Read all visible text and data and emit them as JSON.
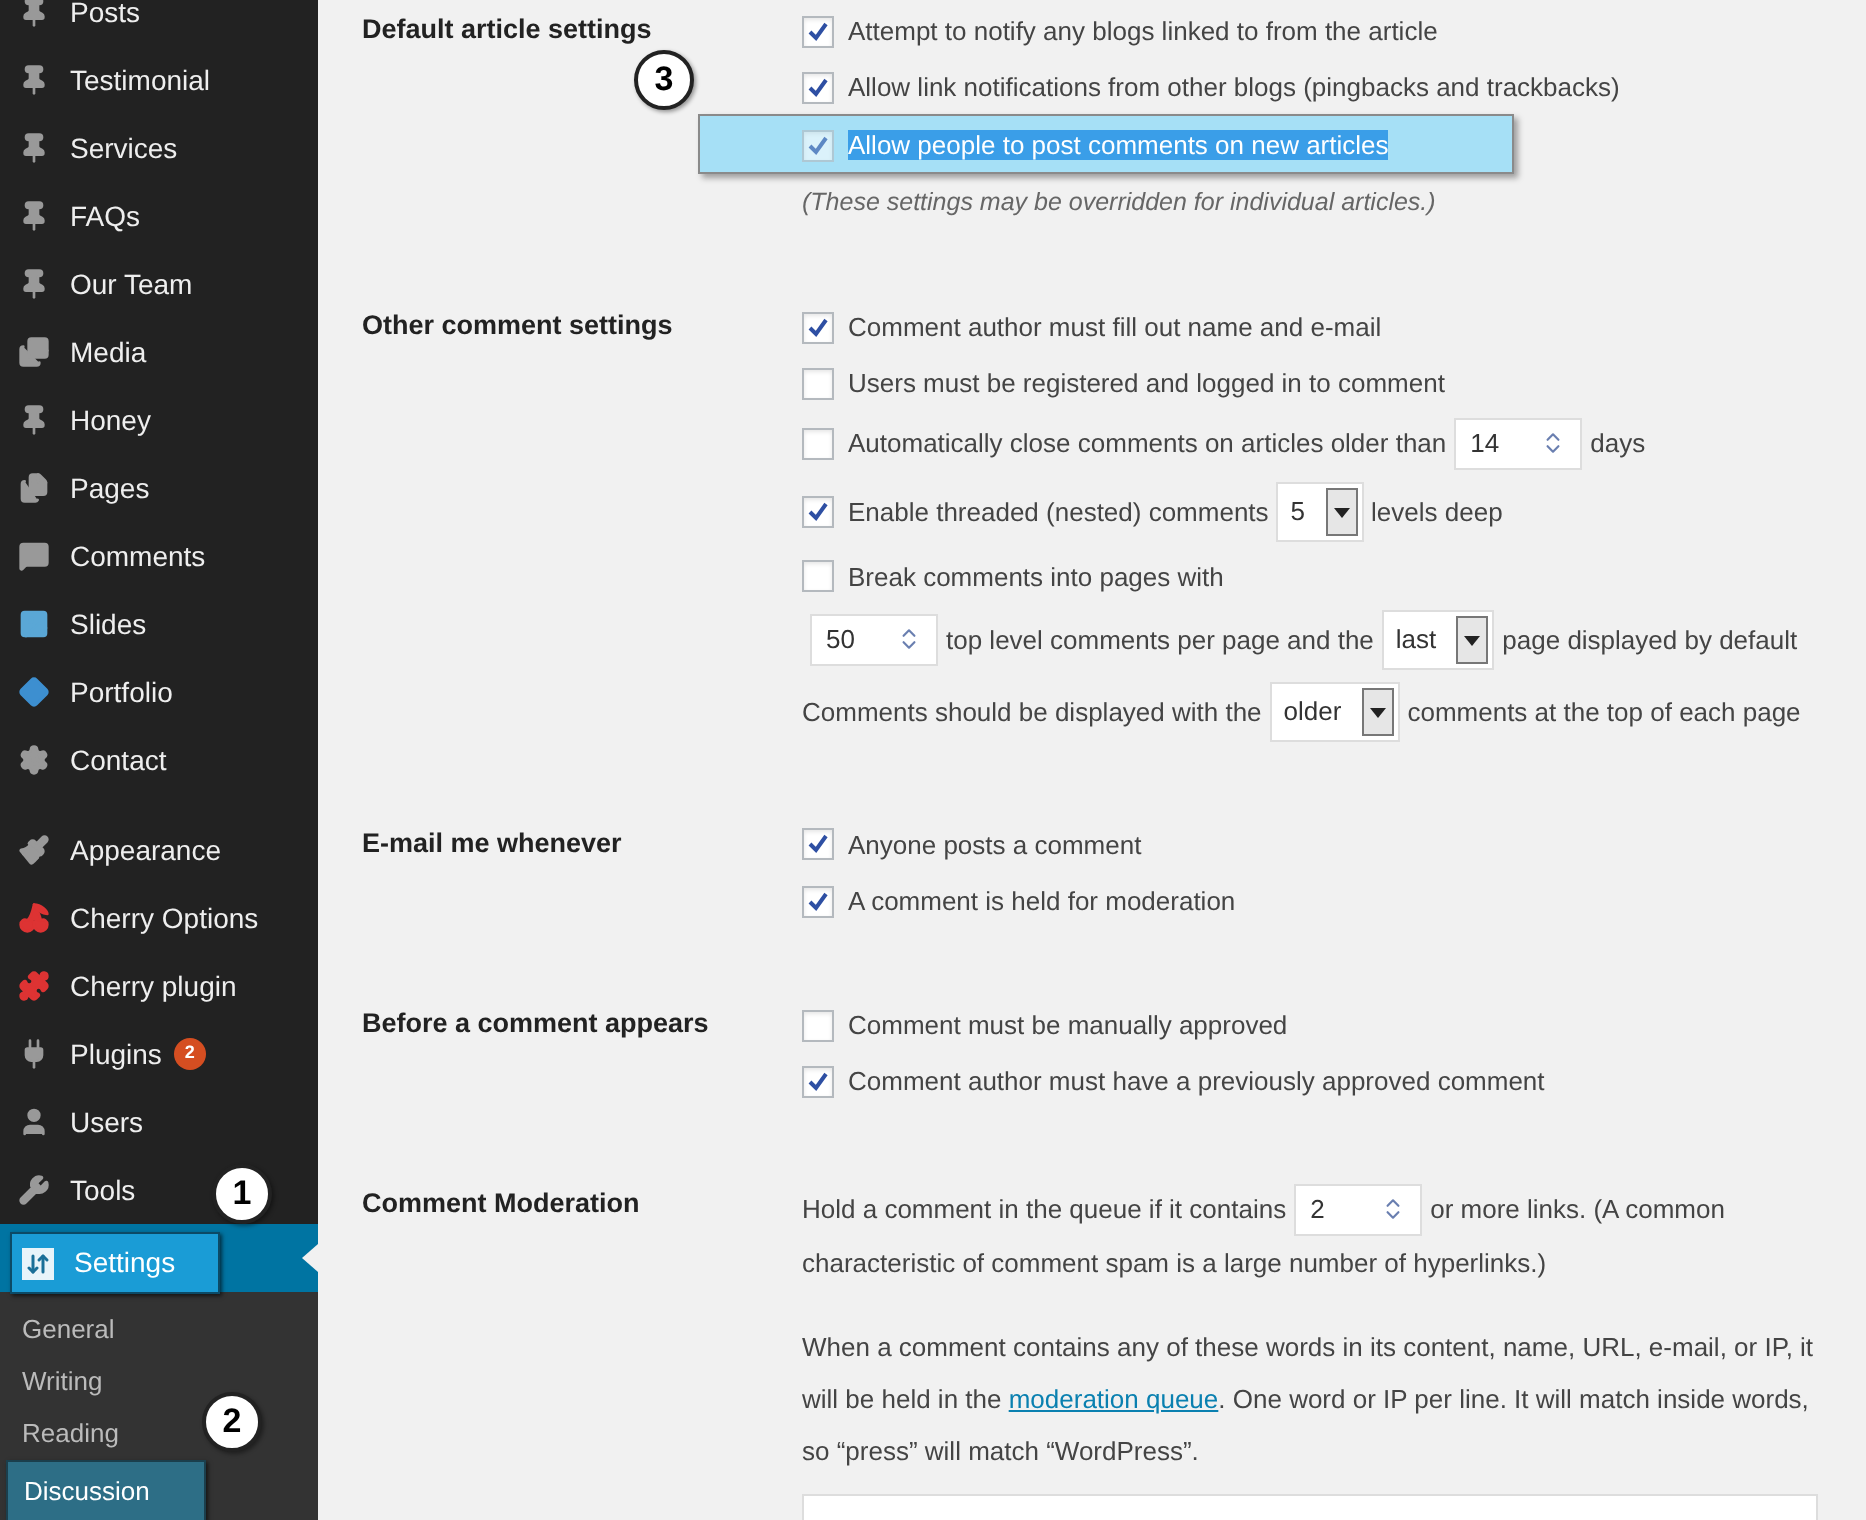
{
  "sidebar": {
    "groups": [
      {
        "items": [
          {
            "label": "Posts",
            "selected": false
          },
          {
            "label": "Testimonial",
            "selected": false
          },
          {
            "label": "Services",
            "selected": false
          },
          {
            "label": "FAQs",
            "selected": false
          },
          {
            "label": "Our Team",
            "selected": false
          },
          {
            "label": "Media",
            "selected": false
          },
          {
            "label": "Honey",
            "selected": false
          },
          {
            "label": "Pages",
            "selected": false
          },
          {
            "label": "Comments",
            "selected": false
          },
          {
            "label": "Slides",
            "selected": false
          },
          {
            "label": "Portfolio",
            "selected": false
          },
          {
            "label": "Contact",
            "selected": false
          }
        ]
      },
      {
        "items": [
          {
            "label": "Appearance",
            "selected": false
          },
          {
            "label": "Cherry Options",
            "selected": false
          },
          {
            "label": "Cherry plugin",
            "selected": false
          },
          {
            "label": "Plugins",
            "badge": "2",
            "selected": false
          },
          {
            "label": "Users",
            "selected": false
          },
          {
            "label": "Tools",
            "selected": false
          },
          {
            "label": "Settings",
            "selected": true,
            "children": [
              {
                "label": "General",
                "selected": false
              },
              {
                "label": "Writing",
                "selected": false
              },
              {
                "label": "Reading",
                "selected": false
              },
              {
                "label": "Discussion",
                "selected": true
              }
            ]
          }
        ]
      }
    ]
  },
  "annotations": [
    "1",
    "2",
    "3"
  ],
  "sections": [
    {
      "title": "Default article settings",
      "rows": [
        {
          "highlighted": false,
          "parts": [
            {
              "kind": "checkbox",
              "checked": true
            },
            {
              "kind": "text",
              "text": "Attempt to notify any blogs linked to from the article"
            }
          ]
        },
        {
          "highlighted": false,
          "parts": [
            {
              "kind": "checkbox",
              "checked": true
            },
            {
              "kind": "text",
              "text": "Allow link notifications from other blogs (pingbacks and trackbacks)"
            }
          ]
        },
        {
          "highlighted": true,
          "parts": [
            {
              "kind": "checkbox",
              "checked": true
            },
            {
              "kind": "text",
              "text": "Allow people to post comments on new articles"
            }
          ]
        },
        {
          "highlighted": false,
          "parts": [
            {
              "kind": "note",
              "text": "(These settings may be overridden for individual articles.)"
            }
          ]
        }
      ]
    },
    {
      "title": "Other comment settings",
      "rows": [
        {
          "parts": [
            {
              "kind": "checkbox",
              "checked": true
            },
            {
              "kind": "text",
              "text": "Comment author must fill out name and e-mail"
            }
          ]
        },
        {
          "parts": [
            {
              "kind": "checkbox",
              "checked": false
            },
            {
              "kind": "text",
              "text": "Users must be registered and logged in to comment"
            }
          ]
        },
        {
          "parts": [
            {
              "kind": "checkbox",
              "checked": false
            },
            {
              "kind": "text",
              "text": "Automatically close comments on articles older than"
            },
            {
              "kind": "number",
              "value": "14"
            },
            {
              "kind": "text",
              "text": "days"
            }
          ]
        },
        {
          "parts": [
            {
              "kind": "checkbox",
              "checked": true
            },
            {
              "kind": "text",
              "text": "Enable threaded (nested) comments"
            },
            {
              "kind": "select",
              "value": "5"
            },
            {
              "kind": "text",
              "text": "levels deep"
            }
          ]
        },
        {
          "parts": [
            {
              "kind": "checkbox",
              "checked": false
            },
            {
              "kind": "text",
              "text": "Break comments into pages with"
            }
          ]
        },
        {
          "parts": [
            {
              "kind": "number",
              "value": "50"
            },
            {
              "kind": "text",
              "text": "top level comments per page and the"
            },
            {
              "kind": "select",
              "value": "last"
            },
            {
              "kind": "text",
              "text": "page displayed by default"
            }
          ]
        },
        {
          "parts": [
            {
              "kind": "text",
              "text": "Comments should be displayed with the"
            },
            {
              "kind": "select",
              "value": "older"
            },
            {
              "kind": "text",
              "text": "comments at the top of each page"
            }
          ]
        }
      ]
    },
    {
      "title": "E-mail me whenever",
      "rows": [
        {
          "parts": [
            {
              "kind": "checkbox",
              "checked": true
            },
            {
              "kind": "text",
              "text": "Anyone posts a comment"
            }
          ]
        },
        {
          "parts": [
            {
              "kind": "checkbox",
              "checked": true
            },
            {
              "kind": "text",
              "text": "A comment is held for moderation"
            }
          ]
        }
      ]
    },
    {
      "title": "Before a comment appears",
      "rows": [
        {
          "parts": [
            {
              "kind": "checkbox",
              "checked": false
            },
            {
              "kind": "text",
              "text": "Comment must be manually approved"
            }
          ]
        },
        {
          "parts": [
            {
              "kind": "checkbox",
              "checked": true
            },
            {
              "kind": "text",
              "text": "Comment author must have a previously approved comment"
            }
          ]
        }
      ]
    },
    {
      "title": "Comment Moderation",
      "rows": [
        {
          "parts": [
            {
              "kind": "text",
              "text": "Hold a comment in the queue if it contains"
            },
            {
              "kind": "number",
              "value": "2"
            },
            {
              "kind": "text",
              "text": "or more links. (A common characteristic of comment spam is a large number of hyperlinks.)"
            }
          ]
        },
        {
          "kind": "paragraph",
          "parts": [
            {
              "kind": "text",
              "text": "When a comment contains any of these words in its content, name, URL, e-mail, or IP, it will be held in the "
            },
            {
              "kind": "link",
              "text": "moderation queue"
            },
            {
              "kind": "text",
              "text": ". One word or IP per line. It will match inside words, so “press” will match “WordPress”."
            }
          ]
        },
        {
          "parts": [
            {
              "kind": "textarea"
            }
          ]
        }
      ]
    }
  ]
}
